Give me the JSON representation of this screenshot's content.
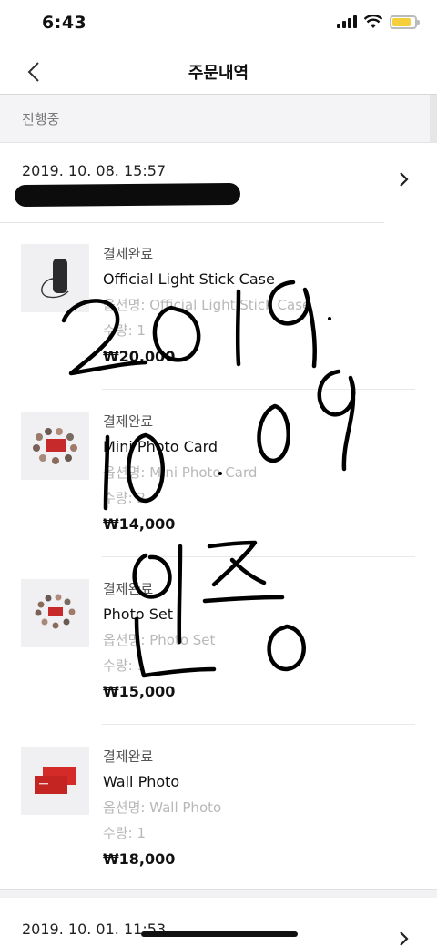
{
  "status_bar": {
    "time": "6:43"
  },
  "nav": {
    "title": "주문내역"
  },
  "section": {
    "label": "진행중"
  },
  "orders": [
    {
      "date": "2019. 10. 08. 15:57",
      "items": [
        {
          "status": "결제완료",
          "name": "Official Light Stick Case",
          "option": "옵션명: Official Light Stick Case",
          "quantity": "수량: 1",
          "price": "₩20,000",
          "thumb": "light-stick-case"
        },
        {
          "status": "결제완료",
          "name": "Mini Photo Card",
          "option": "옵션명: Mini Photo Card",
          "quantity": "수량: 2",
          "price": "₩14,000",
          "thumb": "mini-photo-card"
        },
        {
          "status": "결제완료",
          "name": "Photo Set",
          "option": "옵션명: Photo Set",
          "quantity": "수량: 1",
          "price": "₩15,000",
          "thumb": "photo-set"
        },
        {
          "status": "결제완료",
          "name": "Wall Photo",
          "option": "옵션명: Wall Photo",
          "quantity": "수량: 1",
          "price": "₩18,000",
          "thumb": "wall-photo"
        }
      ]
    },
    {
      "date": "2019. 10. 01. 11:53"
    }
  ],
  "annotation": {
    "handwriting": "2019. 10. 09 인증"
  },
  "colors": {
    "accent_text": "#111111",
    "muted_text": "#b8b8b8",
    "section_bg": "#f4f4f6",
    "battery": "#f5cf3b",
    "wall_photo_red": "#d42a28"
  }
}
